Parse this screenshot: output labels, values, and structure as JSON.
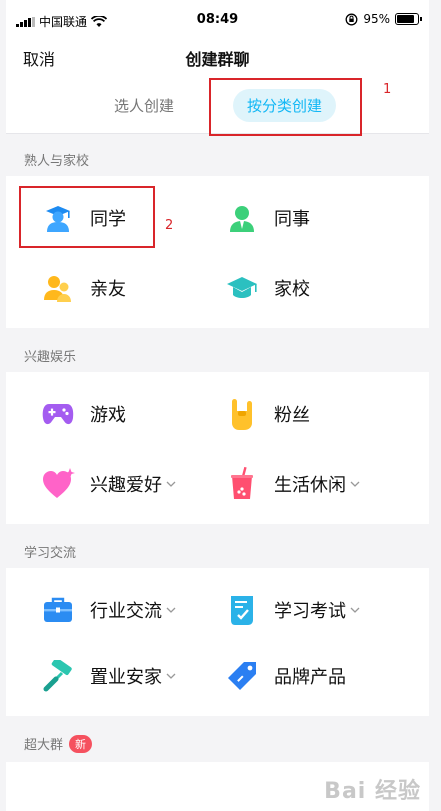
{
  "status_bar": {
    "carrier": "中国联通",
    "time": "08:49",
    "battery": "95%"
  },
  "nav": {
    "cancel": "取消",
    "title": "创建群聊"
  },
  "tabs": {
    "people": "选人创建",
    "category": "按分类创建"
  },
  "annotations": {
    "one": "1",
    "two": "2"
  },
  "sections": [
    {
      "title": "熟人与家校",
      "items": [
        "同学",
        "同事",
        "亲友",
        "家校"
      ]
    },
    {
      "title": "兴趣娱乐",
      "items": [
        "游戏",
        "粉丝",
        "兴趣爱好",
        "生活休闲"
      ]
    },
    {
      "title": "学习交流",
      "items": [
        "行业交流",
        "学习考试",
        "置业安家",
        "品牌产品"
      ]
    }
  ],
  "super_group": {
    "title": "超大群",
    "badge": "新"
  },
  "watermark": "Bai 经验",
  "colors": {
    "accent": "#12b7f5",
    "annotation": "#d9252a",
    "badge": "#f5515f"
  }
}
